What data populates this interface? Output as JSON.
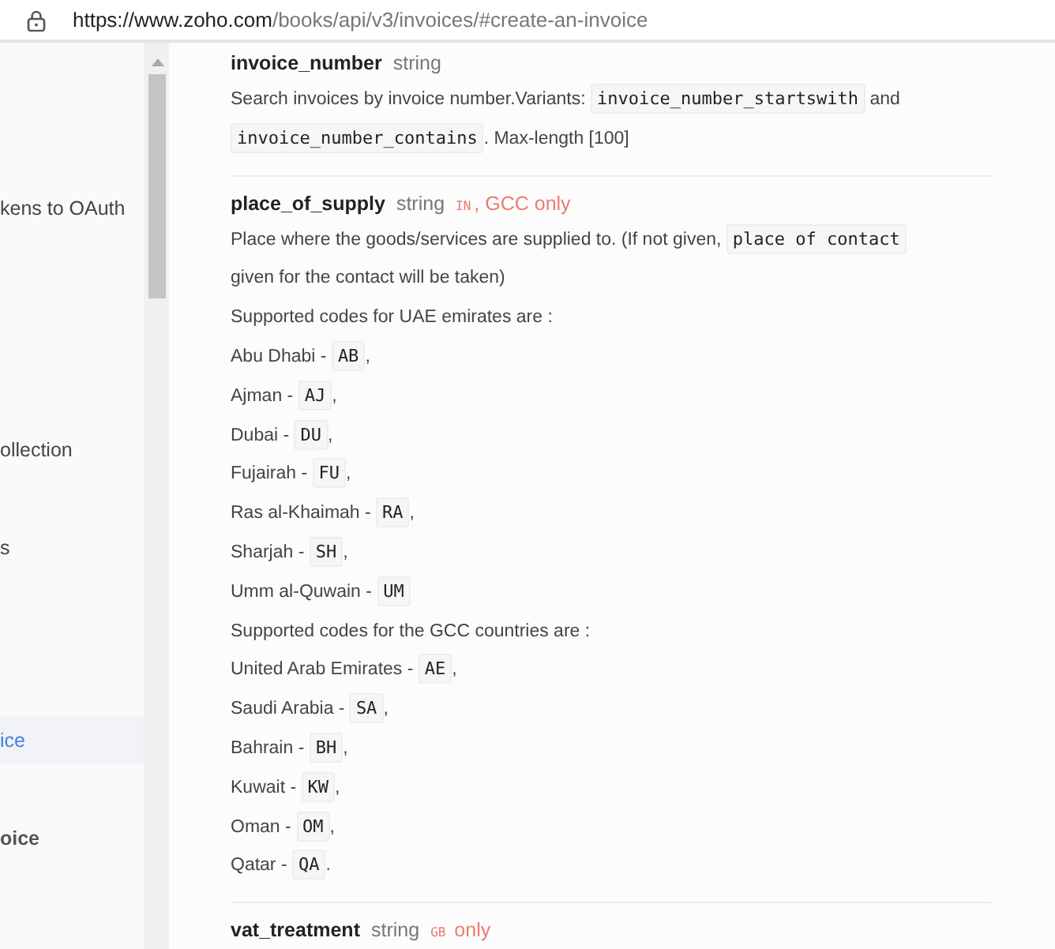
{
  "address_bar": {
    "url_host": "https://www.zoho.com",
    "url_path": "/books/api/v3/invoices/#create-an-invoice"
  },
  "sidebar": {
    "items": [
      {
        "label": "kens to OAuth",
        "selected": false,
        "kind": "plain"
      },
      {
        "label": "ollection",
        "selected": false,
        "kind": "plain"
      },
      {
        "label": "s",
        "selected": false,
        "kind": "plain"
      },
      {
        "label": "ice",
        "selected": true,
        "kind": "plain"
      },
      {
        "label": "oice",
        "selected": false,
        "kind": "heading"
      }
    ]
  },
  "fields": [
    {
      "name": "invoice_number",
      "type": "string",
      "paragraphs": [
        [
          {
            "kind": "text",
            "text": "Search invoices by invoice number.Variants: "
          },
          {
            "kind": "code",
            "text": "invoice_number_startswith"
          },
          {
            "kind": "text",
            "text": " and "
          },
          {
            "kind": "code",
            "text": "invoice_number_contains"
          },
          {
            "kind": "text",
            "text": ". Max-length [100]"
          }
        ]
      ]
    },
    {
      "name": "place_of_supply",
      "type": "string",
      "tags": [
        {
          "kind": "code",
          "text": "IN"
        },
        {
          "kind": "text",
          "text": ", GCC only"
        }
      ],
      "paragraphs": [
        [
          {
            "kind": "text",
            "text": "Place where the goods/services are supplied to. (If not given, "
          },
          {
            "kind": "code",
            "text": "place of contact"
          },
          {
            "kind": "text",
            "text": " given for the contact will be taken)"
          }
        ],
        [
          {
            "kind": "text",
            "text": "Supported codes for UAE emirates are :"
          }
        ],
        [
          {
            "kind": "text",
            "text": "Abu Dhabi - "
          },
          {
            "kind": "code",
            "text": "AB"
          },
          {
            "kind": "text",
            "text": ","
          }
        ],
        [
          {
            "kind": "text",
            "text": "Ajman - "
          },
          {
            "kind": "code",
            "text": "AJ"
          },
          {
            "kind": "text",
            "text": ","
          }
        ],
        [
          {
            "kind": "text",
            "text": "Dubai - "
          },
          {
            "kind": "code",
            "text": "DU"
          },
          {
            "kind": "text",
            "text": ","
          }
        ],
        [
          {
            "kind": "text",
            "text": "Fujairah - "
          },
          {
            "kind": "code",
            "text": "FU"
          },
          {
            "kind": "text",
            "text": ","
          }
        ],
        [
          {
            "kind": "text",
            "text": "Ras al-Khaimah - "
          },
          {
            "kind": "code",
            "text": "RA"
          },
          {
            "kind": "text",
            "text": ","
          }
        ],
        [
          {
            "kind": "text",
            "text": "Sharjah - "
          },
          {
            "kind": "code",
            "text": "SH"
          },
          {
            "kind": "text",
            "text": ","
          }
        ],
        [
          {
            "kind": "text",
            "text": "Umm al-Quwain - "
          },
          {
            "kind": "code",
            "text": "UM"
          }
        ],
        [
          {
            "kind": "text",
            "text": "Supported codes for the GCC countries are :"
          }
        ],
        [
          {
            "kind": "text",
            "text": "United Arab Emirates - "
          },
          {
            "kind": "code",
            "text": "AE"
          },
          {
            "kind": "text",
            "text": ","
          }
        ],
        [
          {
            "kind": "text",
            "text": "Saudi Arabia - "
          },
          {
            "kind": "code",
            "text": "SA"
          },
          {
            "kind": "text",
            "text": ","
          }
        ],
        [
          {
            "kind": "text",
            "text": "Bahrain - "
          },
          {
            "kind": "code",
            "text": "BH"
          },
          {
            "kind": "text",
            "text": ","
          }
        ],
        [
          {
            "kind": "text",
            "text": "Kuwait - "
          },
          {
            "kind": "code",
            "text": "KW"
          },
          {
            "kind": "text",
            "text": ","
          }
        ],
        [
          {
            "kind": "text",
            "text": "Oman - "
          },
          {
            "kind": "code",
            "text": "OM"
          },
          {
            "kind": "text",
            "text": ","
          }
        ],
        [
          {
            "kind": "text",
            "text": "Qatar - "
          },
          {
            "kind": "code",
            "text": "QA"
          },
          {
            "kind": "text",
            "text": "."
          }
        ]
      ]
    },
    {
      "name": "vat_treatment",
      "type": "string",
      "tags": [
        {
          "kind": "code",
          "text": "GB"
        },
        {
          "kind": "text",
          "text": " only"
        }
      ]
    }
  ]
}
